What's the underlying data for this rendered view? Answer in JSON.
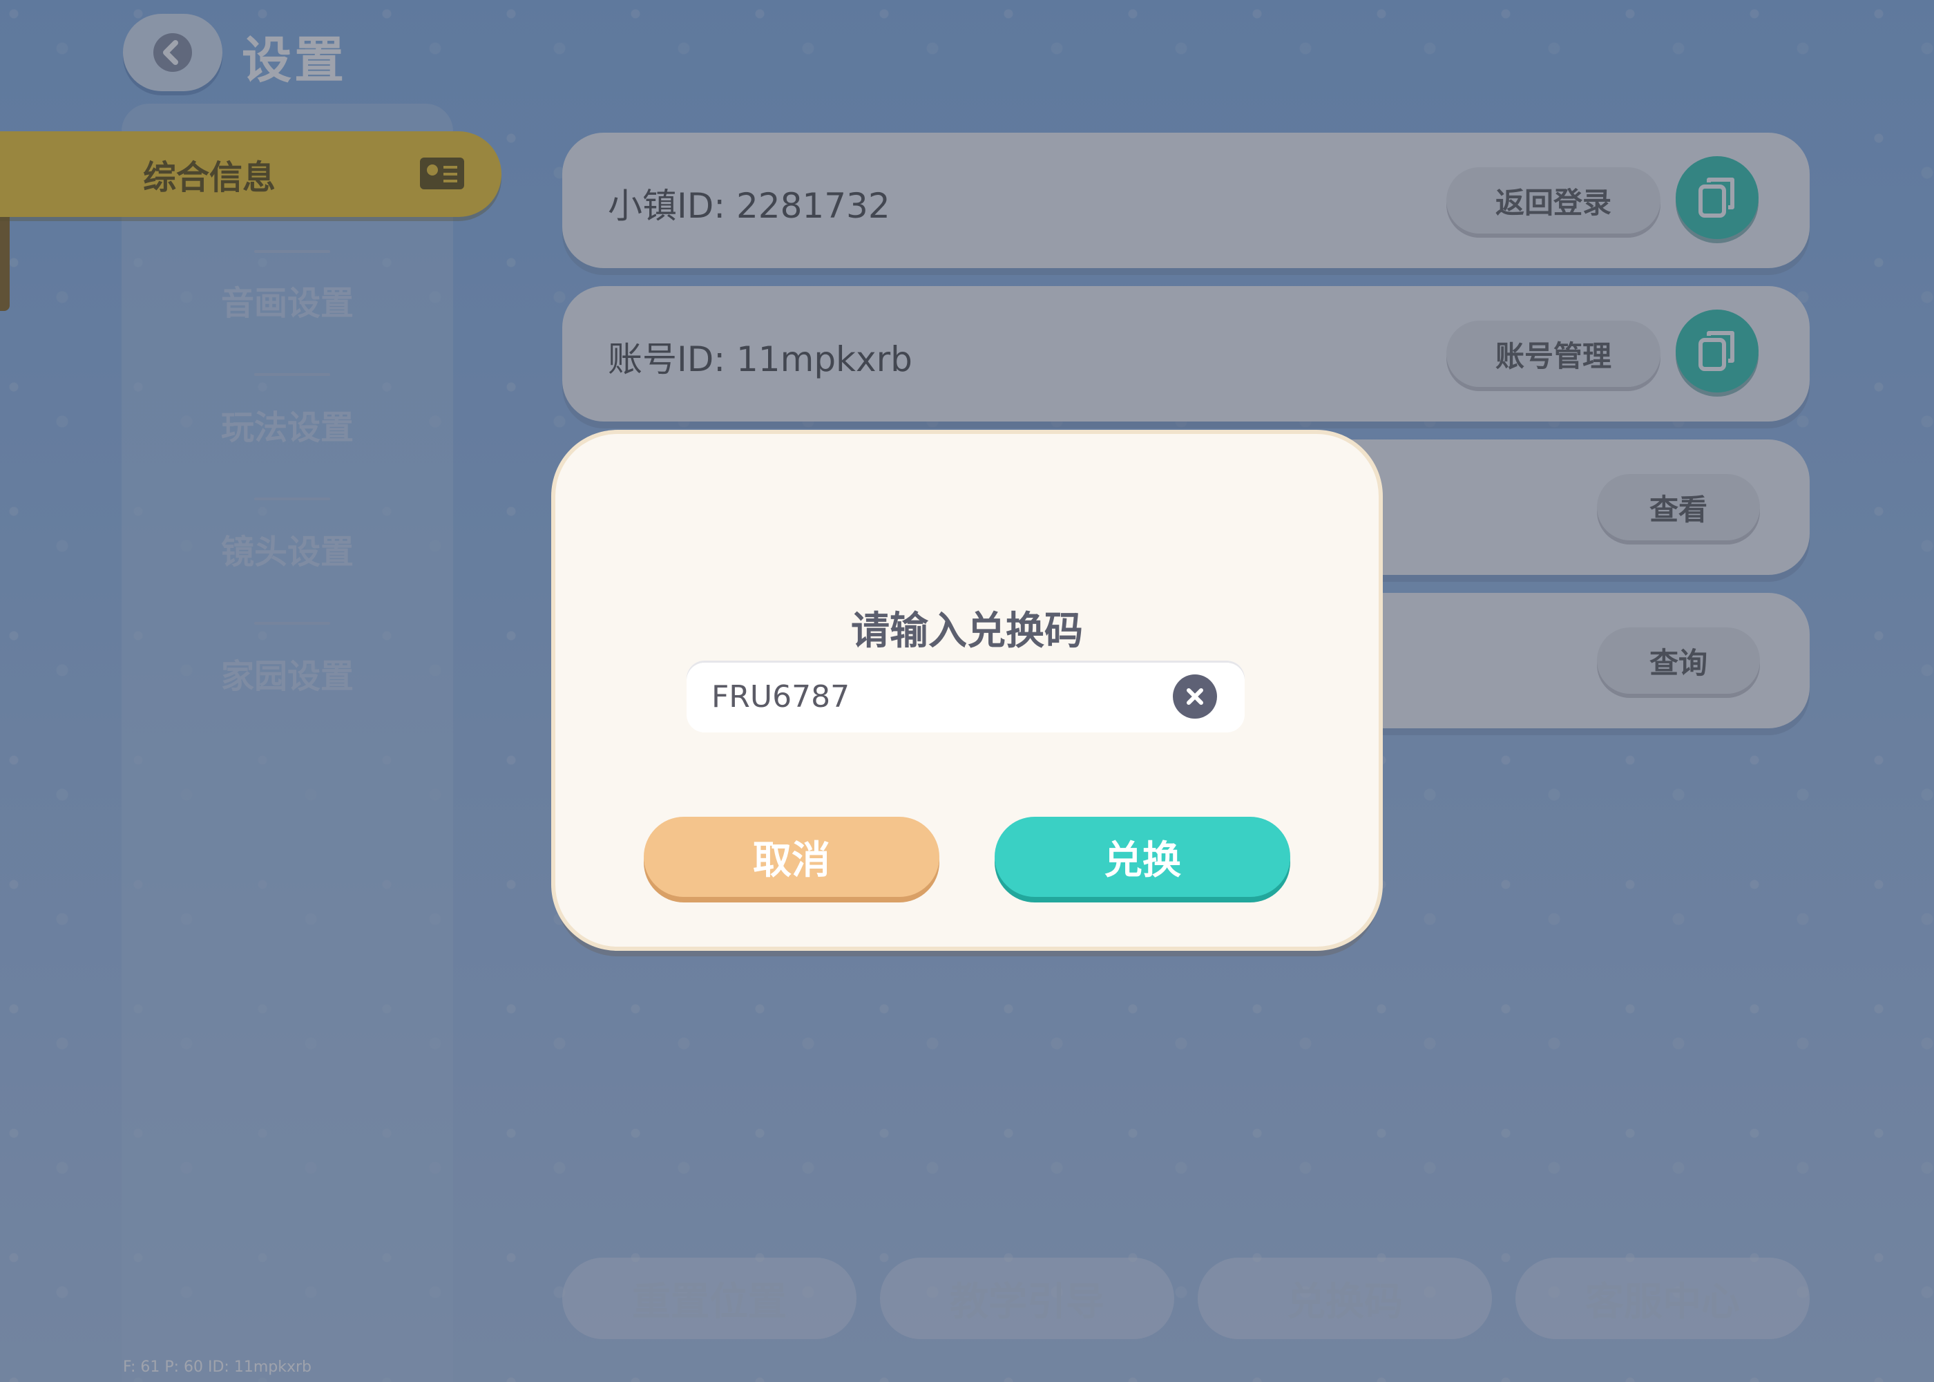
{
  "header": {
    "title": "设置"
  },
  "sidebar": {
    "items": [
      {
        "label": "综合信息",
        "active": true,
        "icon": "id-card-icon"
      },
      {
        "label": "音画设置"
      },
      {
        "label": "玩法设置"
      },
      {
        "label": "镜头设置"
      },
      {
        "label": "家园设置"
      }
    ]
  },
  "rows": [
    {
      "label": "小镇ID:  2281732",
      "button": "返回登录",
      "icon": "copy-icon"
    },
    {
      "label": "账号ID:  11mpkxrb",
      "button": "账号管理",
      "icon": "copy-icon"
    },
    {
      "label": "",
      "button": "查看"
    },
    {
      "label": "",
      "button": "查询"
    }
  ],
  "bottom_buttons": [
    "重置位置",
    "教学引导",
    "兑换码",
    "客服中心"
  ],
  "debug": "F: 61    P: 60    ID: 11mpkxrb",
  "dialog": {
    "title": "请输入兑换码",
    "input_value": "FRU6787",
    "cancel_label": "取消",
    "confirm_label": "兑换"
  },
  "colors": {
    "accent_yellow": "#f6cc3a",
    "copy_teal": "#3fc9b3",
    "cancel_orange": "#f4c48c",
    "confirm_teal": "#3ad0c4"
  }
}
